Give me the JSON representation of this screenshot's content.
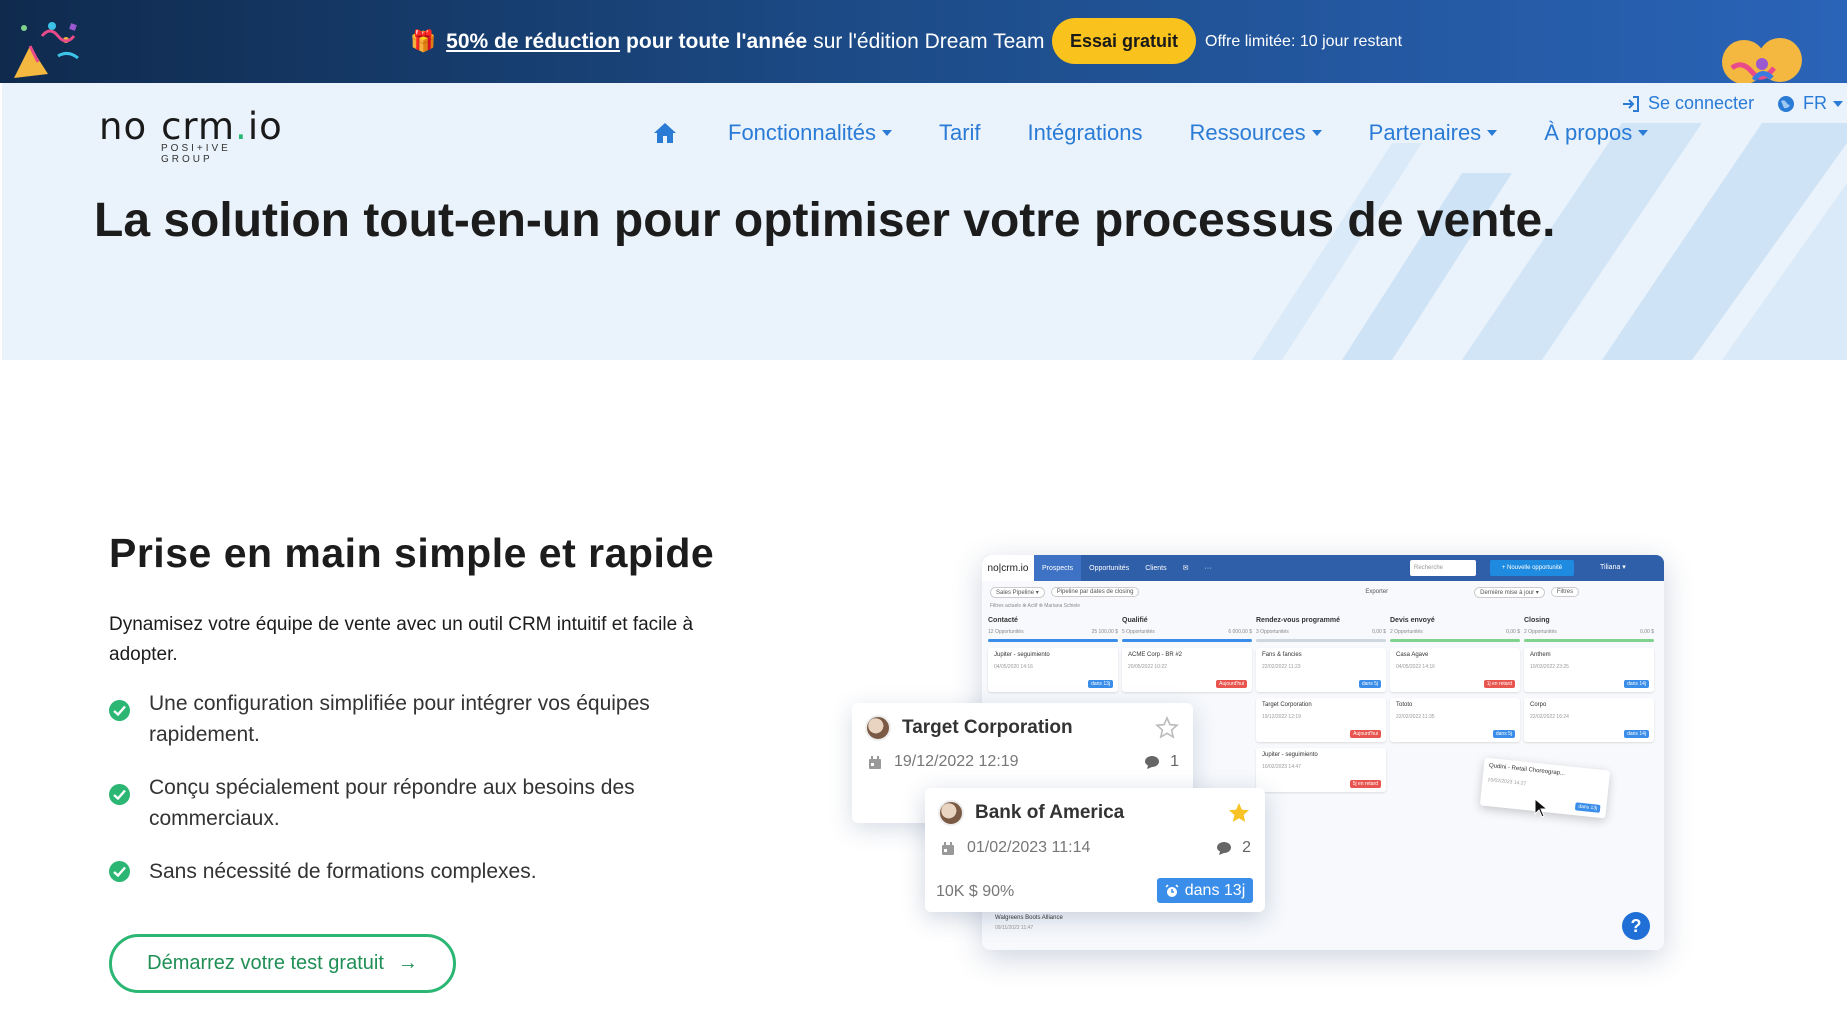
{
  "promo": {
    "gift_icon": "🎁",
    "highlight": "50% de réduction",
    "bold_text": "pour toute l'année",
    "normal_text": "sur l'édition Dream Team",
    "button": "Essai gratuit",
    "offer": "Offre limitée: 10 jour restant"
  },
  "header": {
    "logo": {
      "left": "no",
      "right_a": "crm",
      "dot": ".",
      "right_b": "io",
      "sub": "POSI+IVE GROUP"
    },
    "nav": [
      "Fonctionnalités",
      "Tarif",
      "Intégrations",
      "Ressources",
      "Partenaires",
      "À propos"
    ],
    "login": "Se connecter",
    "lang": "FR"
  },
  "hero": {
    "title": "La solution tout-en-un pour optimiser votre processus de vente."
  },
  "feature": {
    "title": "Prise en main simple et rapide",
    "description": "Dynamisez votre équipe de vente avec un outil CRM intuitif et facile à adopter.",
    "bullets": [
      "Une configuration simplifiée pour intégrer vos équipes rapidement.",
      "Conçu spécialement pour répondre aux besoins des commerciaux.",
      "Sans nécessité de formations complexes."
    ],
    "cta": "Démarrez votre test gratuit",
    "cta_arrow": "→"
  },
  "mock": {
    "logo": "no|crm.io",
    "tabs": [
      "Prospects",
      "Opportunités",
      "Clients",
      "✉",
      "···"
    ],
    "search": "Recherche",
    "new_button": "+ Nouvelle opportunité",
    "user": "Tiliana ▾",
    "toolbar": [
      "Sales Pipeline ▾",
      "Pipeline par dates de closing",
      "Exporter",
      "Dernière mise à jour ▾",
      "Filtres"
    ],
    "filters": "Filtres actuels  ⊗ Actif  ⊗ Mariana Schiele",
    "columns": [
      {
        "name": "Contacté",
        "meta_left": "12 Opportunités",
        "meta_right": "25 100,00 $",
        "color": "#3a8de8",
        "cards": [
          {
            "name": "Jupiter - seguimiento",
            "date": "04/05/2020 14:16",
            "tag": "dans 13j",
            "tag_color": "#3a8de8"
          }
        ]
      },
      {
        "name": "Qualifié",
        "meta_left": "5 Opportunités",
        "meta_right": "6 000,00 $",
        "color": "#3a8de8",
        "cards": [
          {
            "name": "ACME Corp - BR #2",
            "date": "20/05/2022 10:22",
            "tag": "Aujourd'hui",
            "tag_color": "#e8554f"
          }
        ]
      },
      {
        "name": "Rendez-vous programmé",
        "meta_left": "3 Opportunités",
        "meta_right": "0,00 $",
        "color": "#cfd6de",
        "cards": [
          {
            "name": "Fans & fancies",
            "date": "22/02/2022 11:23",
            "tag": "dans 5j",
            "tag_color": "#3a8de8"
          },
          {
            "name": "Target Corporation",
            "date": "19/12/2022 12:19",
            "tag": "Aujourd'hui",
            "tag_color": "#e8554f"
          },
          {
            "name": "Jupiter - seguimiento",
            "date": "10/02/2023 14:47",
            "tag": "5j en retard",
            "tag_color": "#e8554f"
          }
        ]
      },
      {
        "name": "Devis envoyé",
        "meta_left": "2 Opportunités",
        "meta_right": "0,00 $",
        "color": "#7fd38c",
        "cards": [
          {
            "name": "Casa Agave",
            "date": "04/05/2022 14:16",
            "tag": "1j en retard",
            "tag_color": "#e8554f"
          },
          {
            "name": "Tototo",
            "date": "22/02/2022 11:35",
            "tag": "dans 5j",
            "tag_color": "#3a8de8"
          }
        ]
      },
      {
        "name": "Closing",
        "meta_left": "2 Opportunités",
        "meta_right": "0,00 $",
        "color": "#7fd38c",
        "cards": [
          {
            "name": "Anthem",
            "date": "10/03/2022 23:25",
            "tag": "dans 14j",
            "tag_color": "#3a8de8"
          },
          {
            "name": "Corpo",
            "date": "22/02/2022 16:24",
            "tag": "dans 14j",
            "tag_color": "#3a8de8"
          }
        ]
      }
    ],
    "drag_card": {
      "name": "Qudini - Retail Choreograp...",
      "date": "15/02/2023 14:27",
      "tag": "dans 13j"
    },
    "small_card": {
      "name": "Walgreens Boots Alliance",
      "date": "09/11/2022 11:47"
    },
    "help": "?"
  },
  "card_target": {
    "title": "Target Corporation",
    "date": "19/12/2022 12:19",
    "comments": "1"
  },
  "card_boa": {
    "title": "Bank of America",
    "date": "01/02/2023 11:14",
    "comments": "2",
    "amount": "10K $   90%",
    "due": "dans 13j"
  },
  "colors": {
    "brand_blue": "#2a7bd6",
    "green": "#2bb673",
    "promo_yellow": "#f9c21c",
    "star": "#f7c325"
  }
}
